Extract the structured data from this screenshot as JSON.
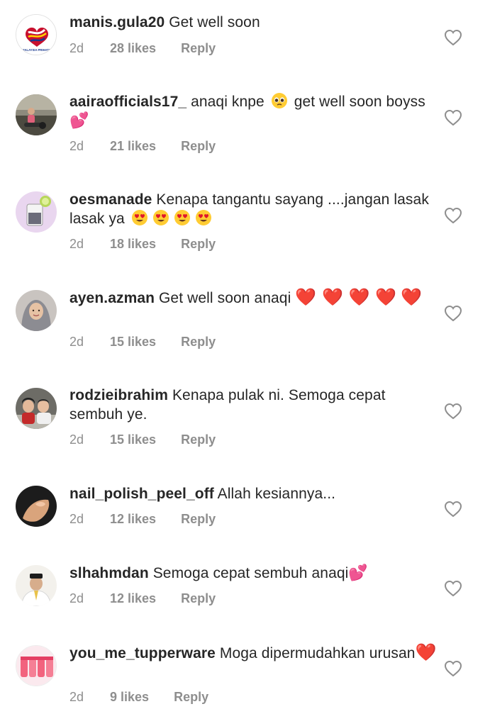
{
  "comments": [
    {
      "username": "manis.gula20",
      "text": "Get well soon",
      "time": "2d",
      "likes": "28 likes",
      "reply": "Reply",
      "avatar_icon": "malaysia-prihatin-logo",
      "avatar_logo_text": "MALAYSIA PRIHATIN"
    },
    {
      "username": "aairaofficials17_",
      "text_before": "anaqi knpe",
      "text_middle": "get well soon boyss",
      "time": "2d",
      "likes": "21 likes",
      "reply": "Reply",
      "emoji_pleading": "pleading-face-emoji",
      "emoji_end": "💕"
    },
    {
      "username": "oesmanade",
      "text": "Kenapa tangantu sayang ....jangan lasak lasak ya",
      "time": "2d",
      "likes": "18 likes",
      "reply": "Reply",
      "emoji": "heart-eyes-emoji"
    },
    {
      "username": "ayen.azman",
      "text": "Get well soon anaqi",
      "hearts": "❤️ ❤️ ❤️ ❤️",
      "hearts_wrap": "❤️",
      "time": "2d",
      "likes": "15 likes",
      "reply": "Reply"
    },
    {
      "username": "rodzieibrahim",
      "text": "Kenapa pulak ni. Semoga cepat sembuh ye.",
      "time": "2d",
      "likes": "15 likes",
      "reply": "Reply"
    },
    {
      "username": "nail_polish_peel_off",
      "text": "Allah kesiannya...",
      "time": "2d",
      "likes": "12 likes",
      "reply": "Reply"
    },
    {
      "username": "slhahmdan",
      "text": "Semoga cepat sembuh anaqi",
      "emoji_end": "💕",
      "time": "2d",
      "likes": "12 likes",
      "reply": "Reply"
    },
    {
      "username": "you_me_tupperware",
      "text": "Moga dipermudahkan urusan",
      "emoji_end": "❤️",
      "time": "2d",
      "likes": "9 likes",
      "reply": "Reply"
    }
  ],
  "colors": {
    "text": "#262626",
    "meta": "#8e8e8e",
    "heart_outline": "#8e8e8e"
  },
  "icons": {
    "like": "heart-outline-icon"
  }
}
